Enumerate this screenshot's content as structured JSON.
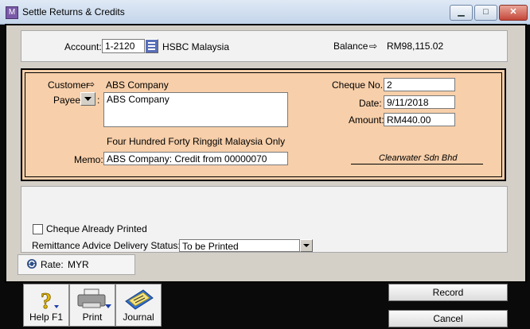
{
  "window": {
    "title": "Settle Returns & Credits",
    "min_glyph": "▁",
    "max_glyph": "□",
    "close_glyph": "✕"
  },
  "account": {
    "label": "Account:",
    "value": "1-2120",
    "name": "HSBC Malaysia",
    "balance_label": "Balance",
    "balance_arrow": "⇨",
    "balance_value": "RM98,115.02"
  },
  "cheque": {
    "customer_label": "Customer",
    "customer_arrow": "⇨",
    "customer_value": "ABS Company",
    "payee_label": "Payee",
    "payee_text": "ABS Company",
    "amount_words": "Four Hundred Forty Ringgit Malaysia Only",
    "memo_label": "Memo:",
    "memo_value": "ABS Company:  Credit from 00000070",
    "cheque_no_label": "Cheque No.:",
    "cheque_no_value": "2",
    "date_label": "Date:",
    "date_value": "9/11/2018",
    "amount_label": "Amount:",
    "amount_value": "RM440.00",
    "signature": "Clearwater Sdn Bhd"
  },
  "options": {
    "already_printed_label": "Cheque Already Printed",
    "already_printed_checked": false,
    "remittance_label": "Remittance Advice Delivery Status:",
    "remittance_value": "To be Printed"
  },
  "rate": {
    "label": "Rate:",
    "value": "MYR"
  },
  "toolbar": {
    "help_label": "Help F1",
    "print_label": "Print",
    "journal_label": "Journal"
  },
  "actions": {
    "record_label": "Record",
    "cancel_label": "Cancel"
  },
  "colors": {
    "cheque_bg": "#f7cfaa",
    "frame_bg": "#d4d0c8",
    "title_bg": "#c4d5ea"
  }
}
